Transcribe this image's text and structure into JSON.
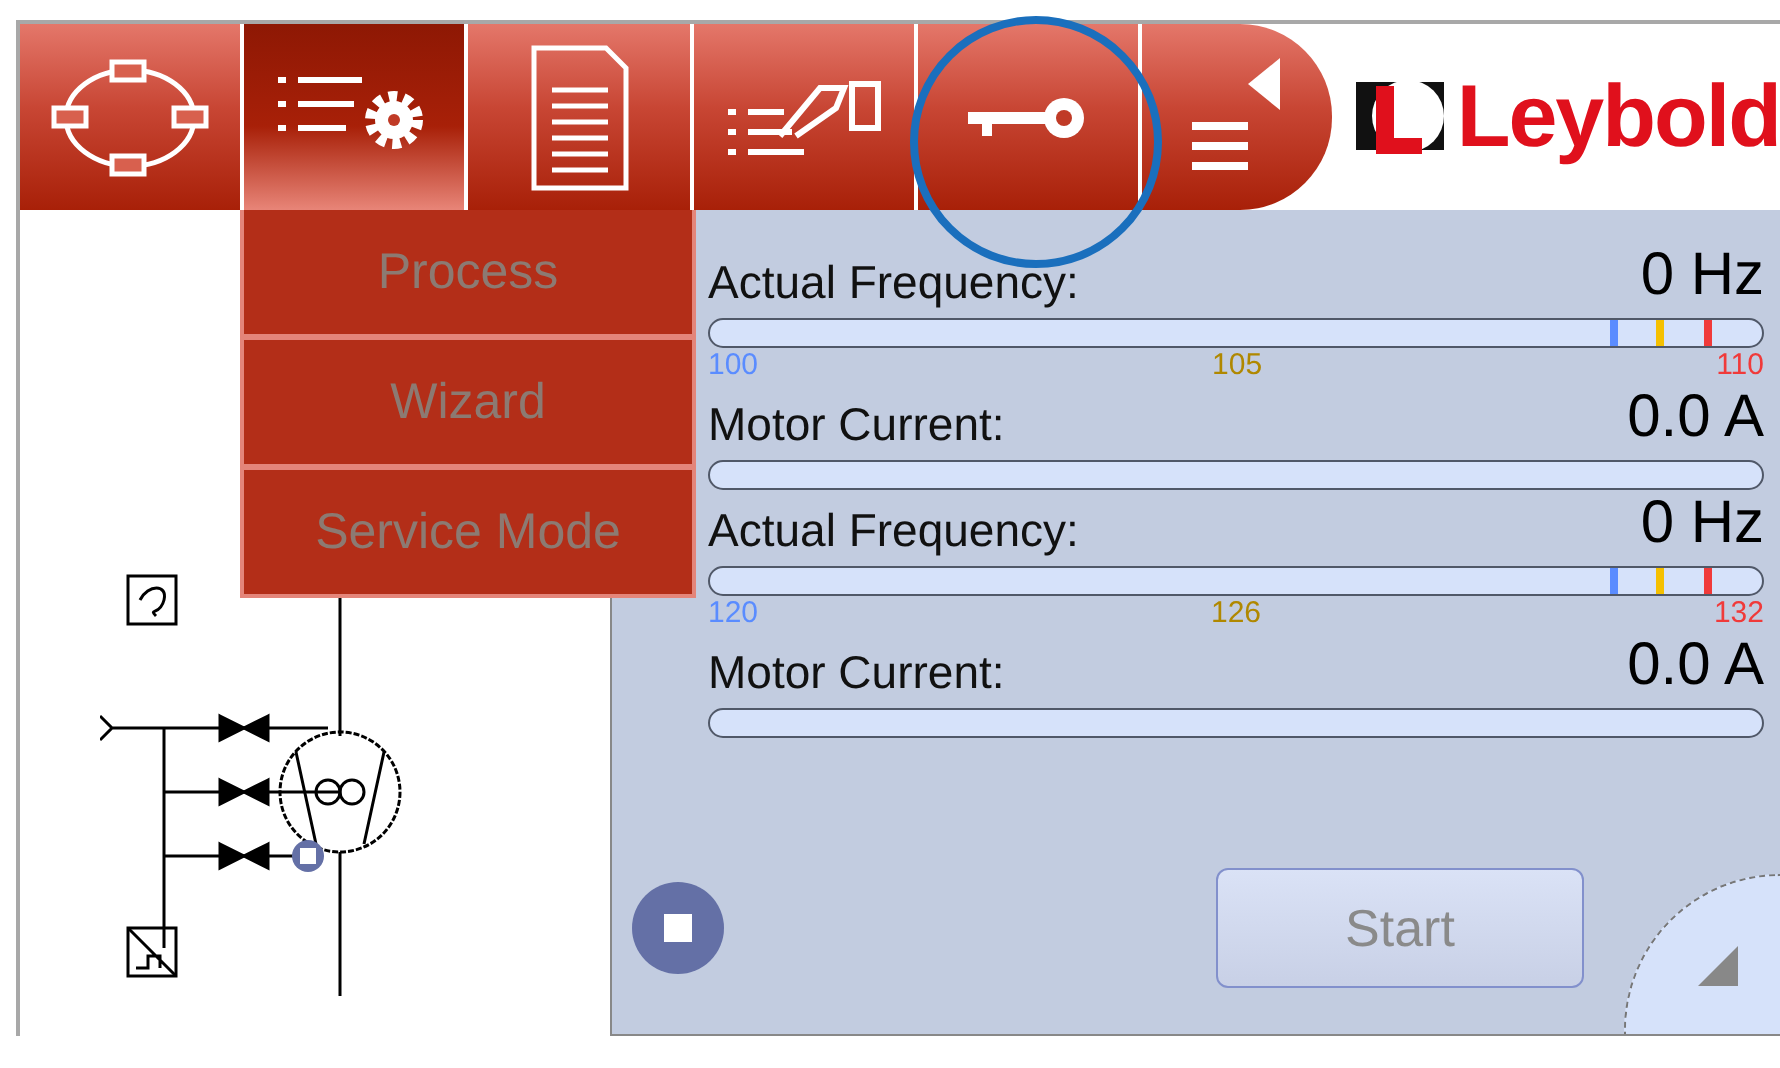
{
  "toolbar": {
    "tabs": [
      {
        "kind": "cycle",
        "selected": false
      },
      {
        "kind": "settings",
        "selected": true
      },
      {
        "kind": "document",
        "selected": false
      },
      {
        "kind": "handover",
        "selected": false
      },
      {
        "kind": "key",
        "selected": false
      },
      {
        "kind": "menu",
        "selected": false
      }
    ],
    "logo": "Leybold"
  },
  "menu": {
    "items": [
      {
        "label": "Process",
        "disabled": true
      },
      {
        "label": "Wizard",
        "disabled": true
      },
      {
        "label": "Service Mode",
        "disabled": true
      }
    ]
  },
  "gauges": [
    {
      "kind": "frequency",
      "label": "Actual Frequency:",
      "value": "0 Hz",
      "scale": [
        {
          "label": "100",
          "color": "#5a8cff"
        },
        {
          "label": "105",
          "color": "#f5c000"
        },
        {
          "label": "110",
          "color": "#f03a3a"
        }
      ]
    },
    {
      "kind": "current",
      "label": "Motor Current:",
      "value": "0.0 A"
    },
    {
      "kind": "frequency",
      "label": "Actual Frequency:",
      "value": "0 Hz",
      "scale": [
        {
          "label": "120",
          "color": "#5a8cff"
        },
        {
          "label": "126",
          "color": "#f5c000"
        },
        {
          "label": "132",
          "color": "#f03a3a"
        }
      ]
    },
    {
      "kind": "current",
      "label": "Motor Current:",
      "value": "0.0 A"
    }
  ],
  "start_button": {
    "label": "Start",
    "disabled": true
  }
}
